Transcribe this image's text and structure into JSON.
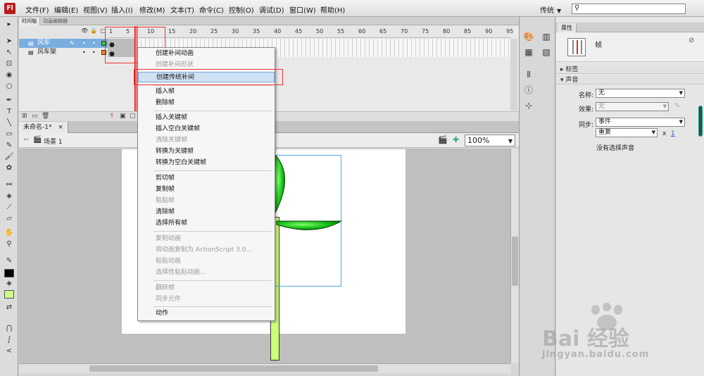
{
  "app": {
    "logo_text": "Fl",
    "menus": [
      "文件(F)",
      "编辑(E)",
      "视图(V)",
      "插入(I)",
      "修改(M)",
      "文本(T)",
      "命令(C)",
      "控制(O)",
      "调试(D)",
      "窗口(W)",
      "帮助(H)"
    ],
    "workspace": "传统",
    "accent_color": "#b61e1e"
  },
  "timeline": {
    "tabs": [
      "时间轴",
      "动画编辑器"
    ],
    "frame_numbers": [
      "1",
      "5",
      "10",
      "15",
      "20",
      "25",
      "30",
      "35",
      "40",
      "45",
      "50",
      "55",
      "60",
      "65",
      "70",
      "75",
      "80",
      "85",
      "90",
      "95"
    ],
    "layers": [
      {
        "name": "风车",
        "color": "#33cc33",
        "selected": true
      },
      {
        "name": "风车架",
        "color": "#ff8800",
        "selected": false
      }
    ]
  },
  "document": {
    "tab_title": "未命名-1*",
    "close_glyph": "×",
    "scene": "场景 1",
    "zoom": "100%"
  },
  "context_menu": {
    "items": [
      {
        "label": "创建补间动画",
        "enabled": true
      },
      {
        "label": "创建补间形状",
        "enabled": false
      },
      {
        "label": "创建传统补间",
        "enabled": true,
        "highlighted": true
      },
      {
        "label": "插入帧",
        "enabled": true
      },
      {
        "label": "删除帧",
        "enabled": true
      },
      {
        "label": "插入关键帧",
        "enabled": true
      },
      {
        "label": "插入空白关键帧",
        "enabled": true
      },
      {
        "label": "清除关键帧",
        "enabled": false
      },
      {
        "label": "转换为关键帧",
        "enabled": true
      },
      {
        "label": "转换为空白关键帧",
        "enabled": true
      },
      {
        "label": "剪切帧",
        "enabled": true
      },
      {
        "label": "复制帧",
        "enabled": true
      },
      {
        "label": "粘贴帧",
        "enabled": false
      },
      {
        "label": "清除帧",
        "enabled": true
      },
      {
        "label": "选择所有帧",
        "enabled": true
      },
      {
        "label": "复制动画",
        "enabled": false
      },
      {
        "label": "将动画复制为 ActionScript 3.0...",
        "enabled": false
      },
      {
        "label": "粘贴动画",
        "enabled": false
      },
      {
        "label": "选择性粘贴动画...",
        "enabled": false
      },
      {
        "label": "翻转帧",
        "enabled": false
      },
      {
        "label": "同步元件",
        "enabled": false
      },
      {
        "label": "动作",
        "enabled": true
      }
    ]
  },
  "properties": {
    "tab": "属性",
    "title": "帧",
    "sections": {
      "label": "标签",
      "sound": "声音"
    },
    "name_label": "名称:",
    "name_value": "无",
    "effect_label": "效果:",
    "effect_value": "无",
    "sync_label": "同步:",
    "sync_value": "事件",
    "repeat_value": "重复",
    "repeat_x": "x",
    "repeat_count": "1",
    "no_sound": "没有选择声音"
  },
  "watermark": {
    "brand": "Bai  经验",
    "url": "jingyan.baidu.com"
  }
}
